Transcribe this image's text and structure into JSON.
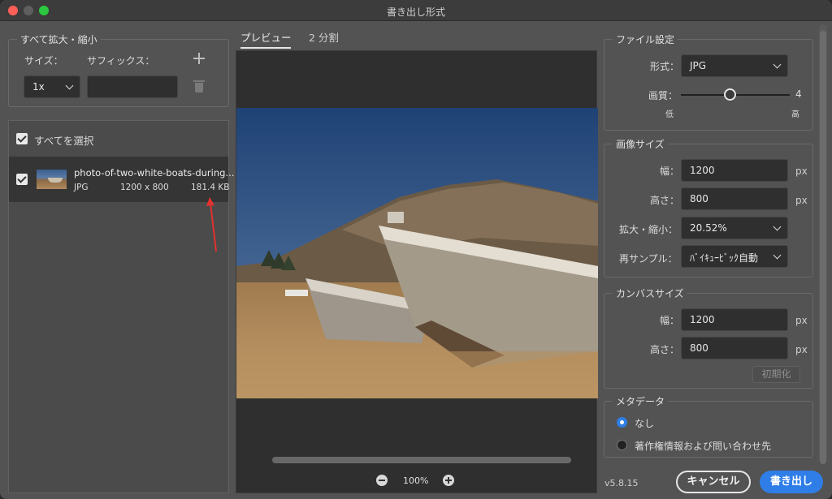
{
  "window": {
    "title": "書き出し形式"
  },
  "scale_group": {
    "title": "すべて拡大・縮小",
    "size_label": "サイズ：",
    "suffix_label": "サフィックス：",
    "scale_value": "1x",
    "suffix_value": ""
  },
  "file_list": {
    "select_all_label": "すべてを選択",
    "select_all_checked": true,
    "items": [
      {
        "name": "photo-of-two-white-boats-during...",
        "format": "JPG",
        "dimensions": "1200 x 800",
        "size": "181.4 KB",
        "checked": true
      }
    ]
  },
  "preview": {
    "tabs": [
      {
        "label": "プレビュー",
        "active": true
      },
      {
        "label": "2 分割",
        "active": false
      }
    ],
    "zoom": "100%"
  },
  "file_settings": {
    "title": "ファイル設定",
    "format_label": "形式：",
    "format_value": "JPG",
    "quality_label": "画質：",
    "quality_value": "4",
    "quality_min_label": "低",
    "quality_max_label": "高",
    "quality_fraction": 0.45
  },
  "image_size": {
    "title": "画像サイズ",
    "width_label": "幅：",
    "width_value": "1200",
    "height_label": "高さ：",
    "height_value": "800",
    "scale_label": "拡大・縮小：",
    "scale_value": "20.52%",
    "resample_label": "再サンプル：",
    "resample_value": "ﾊﾞｲｷｭｰﾋﾞｯｸ自動",
    "unit": "px"
  },
  "canvas_size": {
    "title": "カンバスサイズ",
    "width_label": "幅：",
    "width_value": "1200",
    "height_label": "高さ：",
    "height_value": "800",
    "unit": "px",
    "reset_label": "初期化"
  },
  "metadata": {
    "title": "メタデータ",
    "options": [
      {
        "label": "なし",
        "selected": true
      },
      {
        "label": "著作権情報および問い合わせ先",
        "selected": false
      }
    ]
  },
  "footer": {
    "version": "v5.8.15",
    "cancel_label": "キャンセル",
    "export_label": "書き出し"
  },
  "colors": {
    "accent": "#2f7ee8",
    "panel": "#535353",
    "annotation_arrow": "#e0322f"
  }
}
